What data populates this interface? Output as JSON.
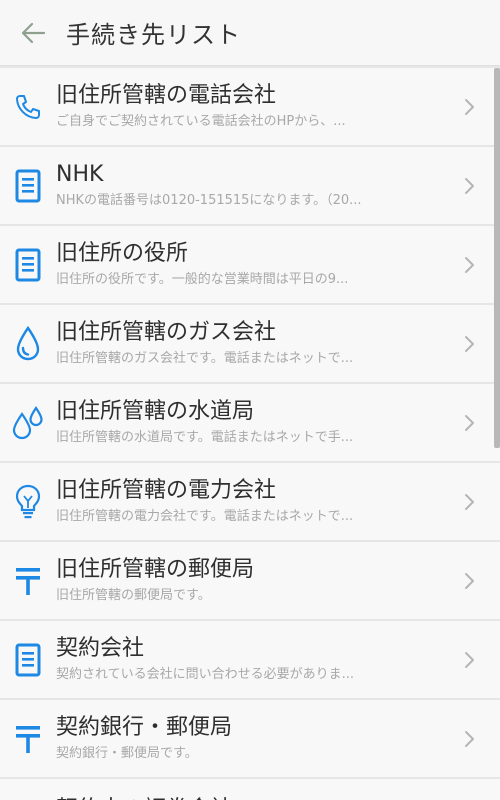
{
  "header": {
    "title": "手続き先リスト"
  },
  "items": [
    {
      "icon": "phone-icon",
      "name": "旧住所管轄の電話会社",
      "desc": "ご自身でご契約されている電話会社のHPから、..."
    },
    {
      "icon": "document-icon",
      "name": "NHK",
      "desc": "NHKの電話番号は0120-151515になります。（20..."
    },
    {
      "icon": "document-icon",
      "name": "旧住所の役所",
      "desc": "旧住所の役所です。一般的な営業時間は平日の9..."
    },
    {
      "icon": "water-drop-icon",
      "name": "旧住所管轄のガス会社",
      "desc": "旧住所管轄のガス会社です。電話またはネットで..."
    },
    {
      "icon": "water-drops-icon",
      "name": "旧住所管轄の水道局",
      "desc": "旧住所管轄の水道局です。電話またはネットで手..."
    },
    {
      "icon": "lightbulb-icon",
      "name": "旧住所管轄の電力会社",
      "desc": "旧住所管轄の電力会社です。電話またはネットで..."
    },
    {
      "icon": "postal-mark-icon",
      "name": "旧住所管轄の郵便局",
      "desc": "旧住所管轄の郵便局です。"
    },
    {
      "icon": "document-icon",
      "name": "契約会社",
      "desc": "契約されている会社に問い合わせる必要がありま..."
    },
    {
      "icon": "postal-mark-icon",
      "name": "契約銀行・郵便局",
      "desc": "契約銀行・郵便局です。"
    }
  ],
  "partial_item": {
    "name": "契約中の証券会社"
  },
  "colors": {
    "accent": "#1e88e5",
    "back_arrow": "#8fa08f"
  }
}
